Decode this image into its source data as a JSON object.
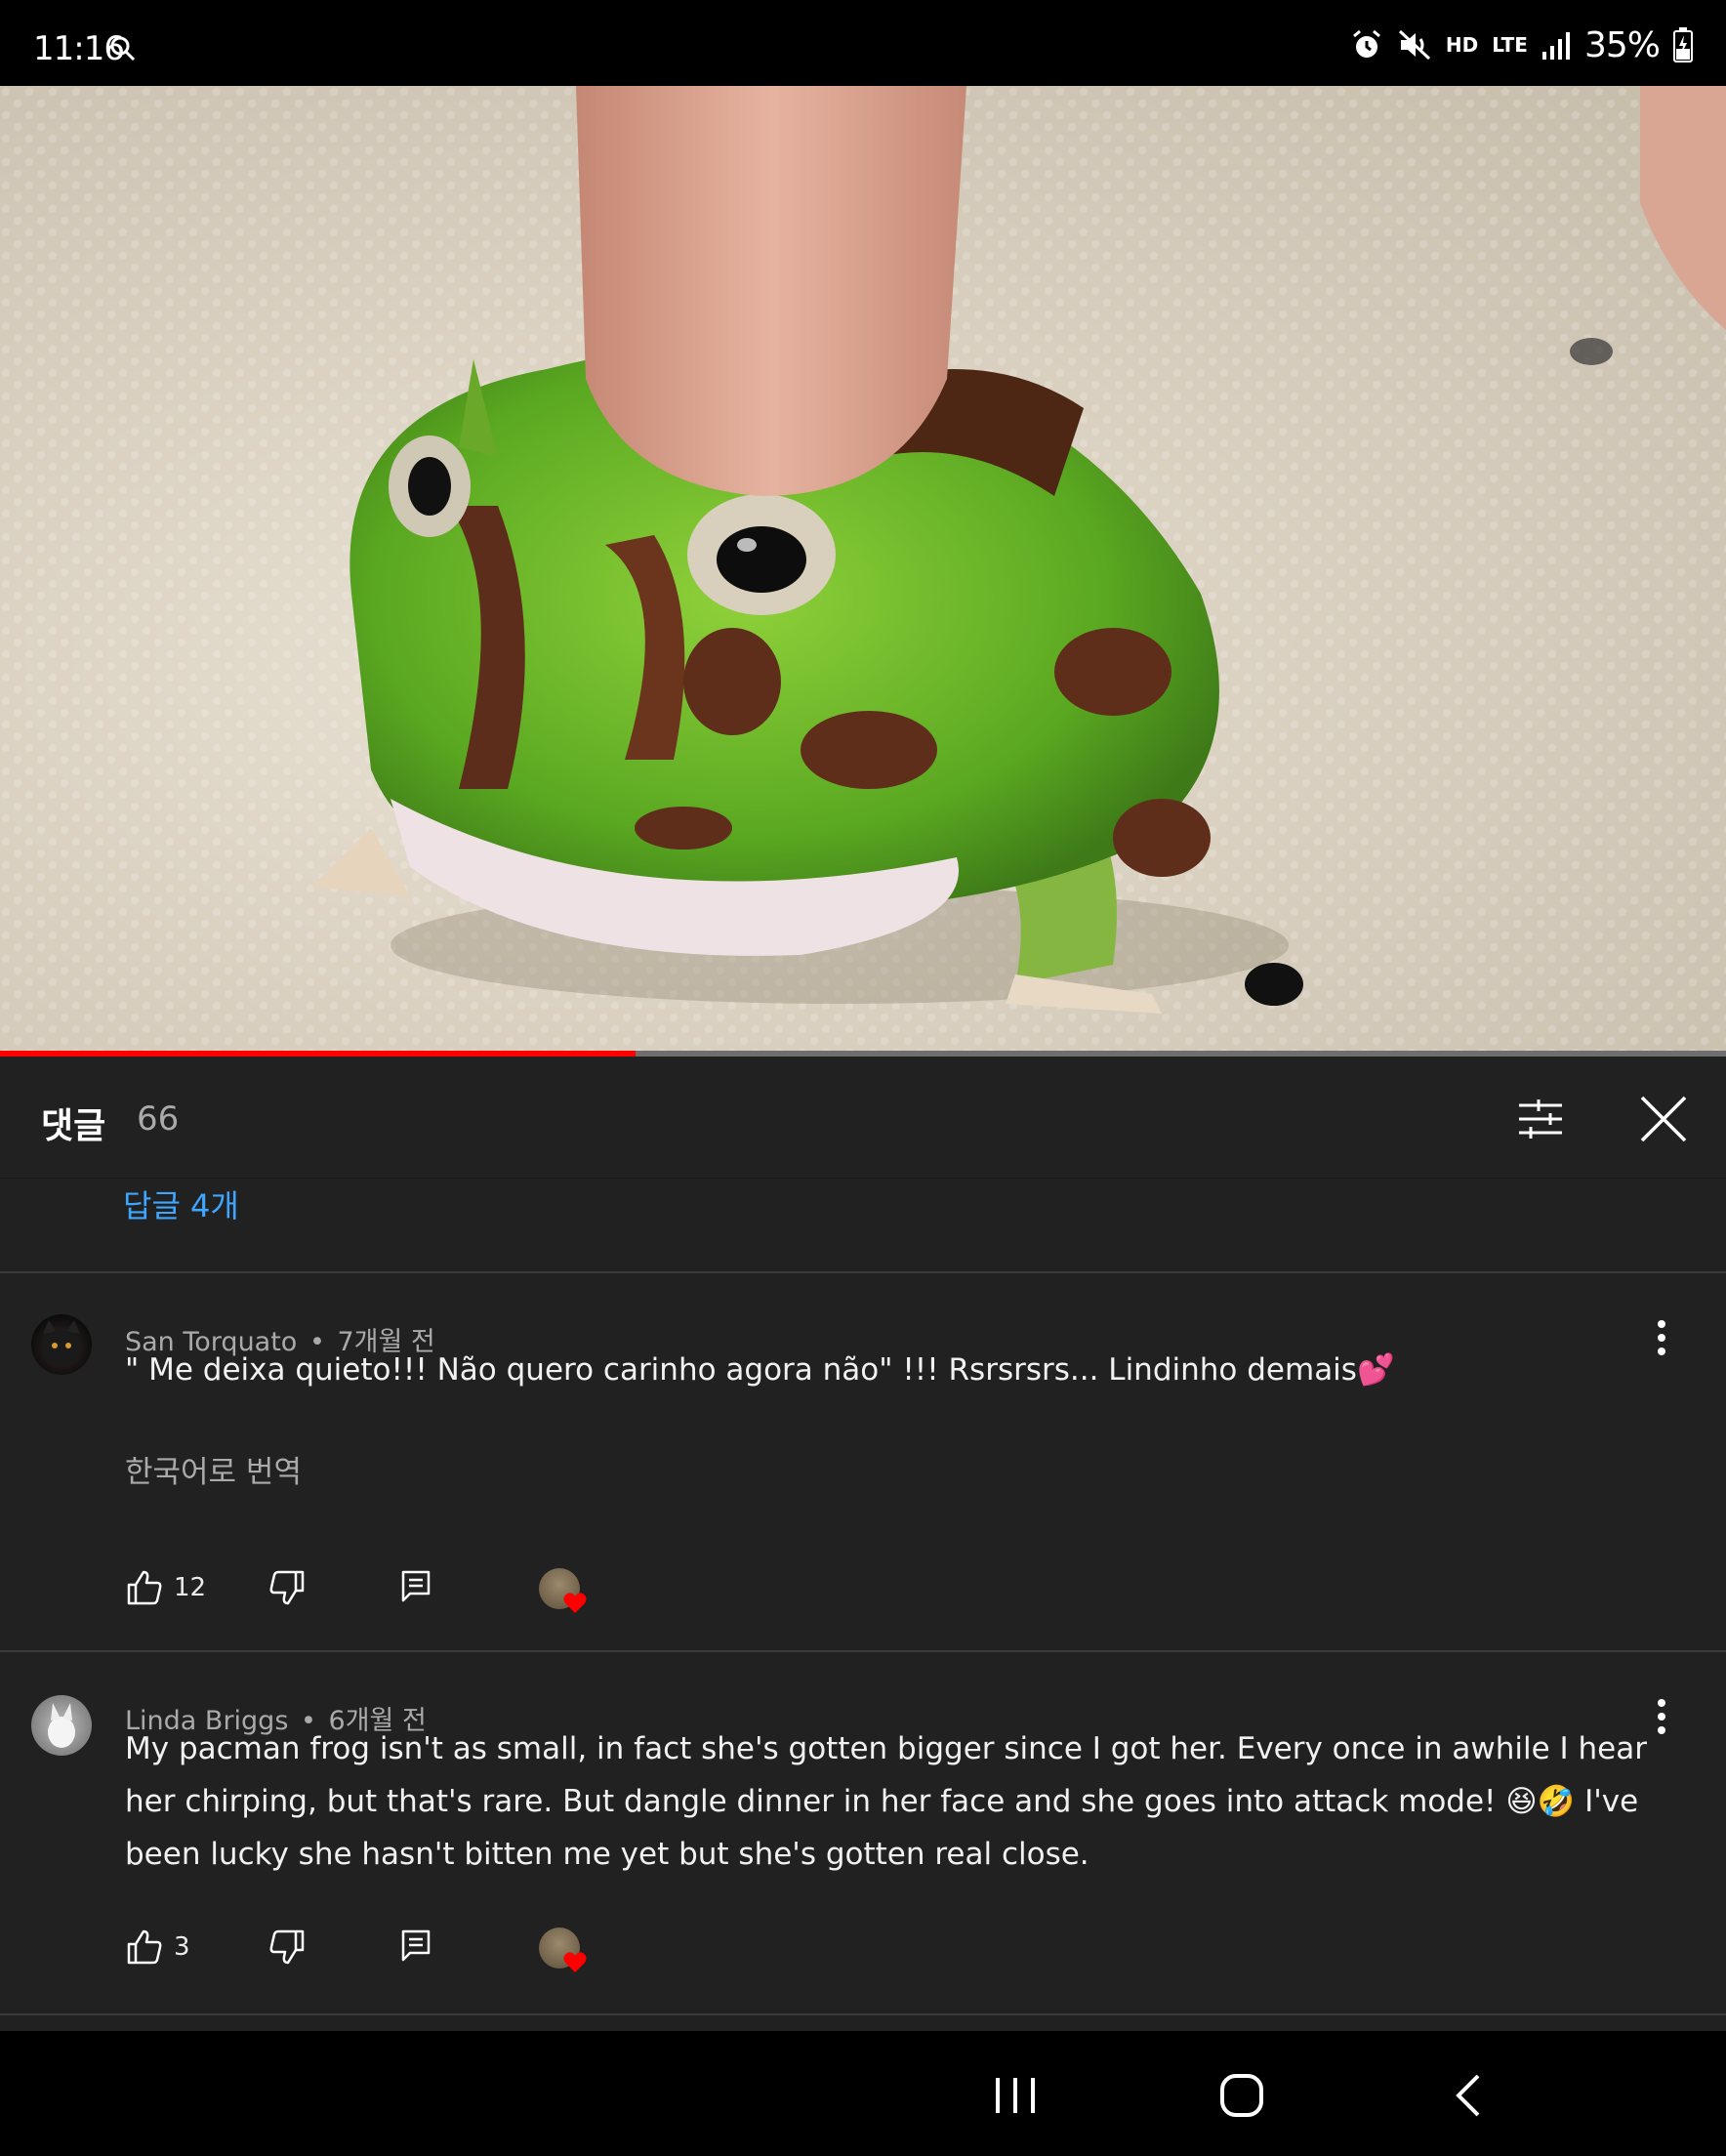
{
  "status_bar": {
    "time": "11:16",
    "battery": "35%",
    "network": "LTE",
    "hd_voice": "HD",
    "icons": [
      "search-icon",
      "alarm-icon",
      "mute-icon",
      "hd-voice-icon",
      "lte-icon",
      "signal-icon",
      "battery-charging-icon"
    ]
  },
  "video": {
    "progress_fraction": 0.368
  },
  "comments_panel": {
    "title": "댓글",
    "count": "66",
    "replies_link": "답글 4개"
  },
  "comments": [
    {
      "author": "San Torquato",
      "separator": "•",
      "time": "7개월 전",
      "text": "\" Me deixa quieto!!! Não quero carinho agora não\" !!!  Rsrsrsrs...  Lindinho demais💕",
      "translate": "한국어로 번역",
      "likes": "12"
    },
    {
      "author": "Linda Briggs",
      "separator": "•",
      "time": "6개월 전",
      "text": "My pacman frog isn't as small, in fact she's gotten bigger since I got her.  Every once in awhile I hear her chirping, but that's rare.  But dangle dinner in her face and she goes into attack mode!  😆🤣  I've been lucky she hasn't bitten me yet but she's gotten real close.",
      "likes": "3"
    }
  ],
  "colors": {
    "background": "#212121",
    "link": "#3ea6ff",
    "progress": "#ff0000"
  }
}
